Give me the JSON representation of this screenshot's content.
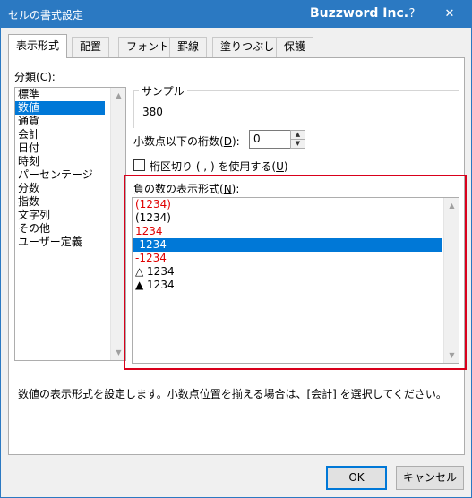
{
  "window": {
    "title": "セルの書式設定",
    "brand": "Buzzword Inc.",
    "help_label": "?",
    "close_label": "✕"
  },
  "tabs": [
    {
      "label": "表示形式",
      "active": true
    },
    {
      "label": "配置"
    },
    {
      "label": "フォント"
    },
    {
      "label": "罫線"
    },
    {
      "label": "塗りつぶし"
    },
    {
      "label": "保護"
    }
  ],
  "category": {
    "label_text": "分類(",
    "label_key": "C",
    "label_tail": "):",
    "items": [
      "標準",
      "数値",
      "通貨",
      "会計",
      "日付",
      "時刻",
      "パーセンテージ",
      "分数",
      "指数",
      "文字列",
      "その他",
      "ユーザー定義"
    ],
    "selected_index": 1
  },
  "sample": {
    "legend": "サンプル",
    "value": "380"
  },
  "decimal_places": {
    "label_text": "小数点以下の桁数(",
    "label_key": "D",
    "label_tail": "):",
    "value": "0"
  },
  "thousands_separator": {
    "label_text": "桁区切り ( , ) を使用する(",
    "label_key": "U",
    "label_tail": ")",
    "checked": false
  },
  "negative_numbers": {
    "label_text": "負の数の表示形式(",
    "label_key": "N",
    "label_tail": "):",
    "items": [
      {
        "text": "(1234)",
        "color": "#e00000"
      },
      {
        "text": "(1234)",
        "color": "#000000"
      },
      {
        "text": "1234",
        "color": "#e00000"
      },
      {
        "text": "-1234",
        "color": "#ffffff",
        "selected": true
      },
      {
        "text": "-1234",
        "color": "#e00000"
      },
      {
        "text": "△ 1234",
        "color": "#000000"
      },
      {
        "text": "▲ 1234",
        "color": "#000000"
      }
    ]
  },
  "description": "数値の表示形式を設定します。小数点位置を揃える場合は、[会計] を選択してください。",
  "buttons": {
    "ok": "OK",
    "cancel": "キャンセル"
  },
  "colors": {
    "titlebar": "#2b79c2",
    "selection": "#0078d7",
    "highlight_border": "#d9001b",
    "negative_red": "#e00000"
  }
}
